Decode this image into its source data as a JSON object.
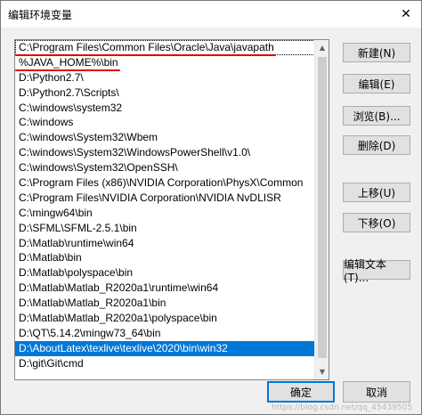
{
  "window": {
    "title": "编辑环境变量",
    "close_glyph": "✕"
  },
  "path_list": {
    "items": [
      "C:\\Program Files\\Common Files\\Oracle\\Java\\javapath",
      "%JAVA_HOME%\\bin",
      "D:\\Python2.7\\",
      "D:\\Python2.7\\Scripts\\",
      "C:\\windows\\system32",
      "C:\\windows",
      "C:\\windows\\System32\\Wbem",
      "C:\\windows\\System32\\WindowsPowerShell\\v1.0\\",
      "C:\\windows\\System32\\OpenSSH\\",
      "C:\\Program Files (x86)\\NVIDIA Corporation\\PhysX\\Common",
      "C:\\Program Files\\NVIDIA Corporation\\NVIDIA NvDLISR",
      "C:\\mingw64\\bin",
      "D:\\SFML\\SFML-2.5.1\\bin",
      "D:\\Matlab\\runtime\\win64",
      "D:\\Matlab\\bin",
      "D:\\Matlab\\polyspace\\bin",
      "D:\\Matlab\\Matlab_R2020a1\\runtime\\win64",
      "D:\\Matlab\\Matlab_R2020a1\\bin",
      "D:\\Matlab\\Matlab_R2020a1\\polyspace\\bin",
      "D:\\QT\\5.14.2\\mingw73_64\\bin",
      "D:\\AboutLatex\\texlive\\texlive\\2020\\bin\\win32",
      "D:\\git\\Git\\cmd"
    ],
    "selected_index": 20,
    "highlighted_indices": [
      0,
      1
    ],
    "highlight_color": "#e00000",
    "selection_color": "#0078d7"
  },
  "side_buttons": {
    "new": "新建(N)",
    "edit": "编辑(E)",
    "browse": "浏览(B)...",
    "delete": "删除(D)",
    "move_up": "上移(U)",
    "move_down": "下移(O)",
    "edit_text": "编辑文本(T)..."
  },
  "footer": {
    "ok": "确定",
    "cancel": "取消"
  },
  "watermark": "https://blog.csdn.net/qq_45439505"
}
